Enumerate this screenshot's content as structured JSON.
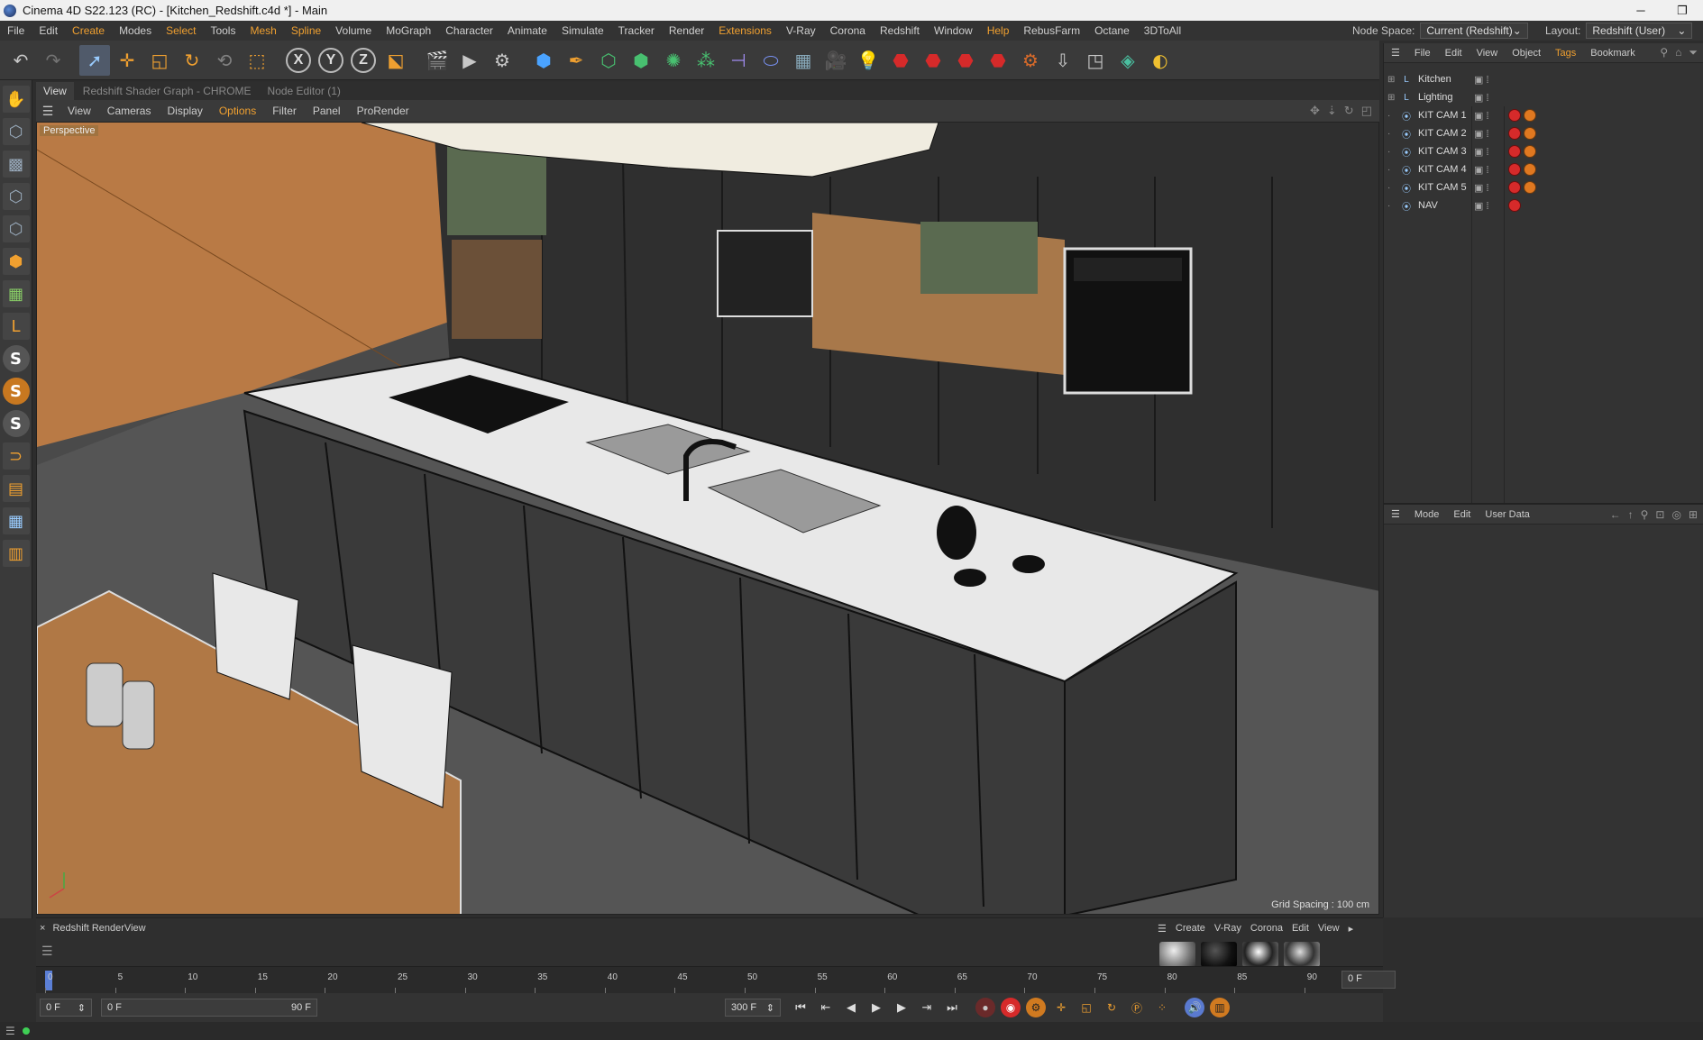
{
  "window": {
    "title": "Cinema 4D S22.123 (RC) - [Kitchen_Redshift.c4d *] - Main",
    "minimize_glyph": "─",
    "restore_glyph": "❐"
  },
  "menubar": {
    "items": [
      "File",
      "Edit",
      "Create",
      "Modes",
      "Select",
      "Tools",
      "Mesh",
      "Spline",
      "Volume",
      "MoGraph",
      "Character",
      "Animate",
      "Simulate",
      "Tracker",
      "Render",
      "Extensions",
      "V-Ray",
      "Corona",
      "Redshift",
      "Window",
      "Help",
      "RebusFarm",
      "Octane",
      "3DToAll"
    ],
    "accent_items": [
      "Create",
      "Select",
      "Mesh",
      "Spline",
      "Extensions",
      "Help"
    ],
    "node_space_label": "Node Space:",
    "node_space_value": "Current (Redshift)",
    "layout_label": "Layout:",
    "layout_value": "Redshift (User)"
  },
  "viewport": {
    "tabs": [
      "View",
      "Redshift Shader Graph - CHROME",
      "Node Editor (1)"
    ],
    "menu": [
      "View",
      "Cameras",
      "Display",
      "Options",
      "Filter",
      "Panel",
      "ProRender"
    ],
    "camera_label": "Perspective",
    "grid_spacing": "Grid Spacing : 100 cm"
  },
  "object_manager": {
    "menu": [
      "File",
      "Edit",
      "View",
      "Object",
      "Tags",
      "Bookmark"
    ],
    "objects": [
      {
        "name": "Kitchen",
        "type": "layer",
        "tags": []
      },
      {
        "name": "Lighting",
        "type": "layer",
        "tags": []
      },
      {
        "name": "KIT CAM 1",
        "type": "camera",
        "tags": [
          "red",
          "orange"
        ]
      },
      {
        "name": "KIT CAM 2",
        "type": "camera",
        "tags": [
          "red",
          "orange"
        ]
      },
      {
        "name": "KIT  CAM 3",
        "type": "camera",
        "tags": [
          "red",
          "orange"
        ]
      },
      {
        "name": "KIT  CAM 4",
        "type": "camera",
        "tags": [
          "red",
          "orange"
        ]
      },
      {
        "name": "KIT  CAM 5",
        "type": "camera",
        "tags": [
          "red",
          "orange"
        ]
      },
      {
        "name": "NAV",
        "type": "camera",
        "tags": [
          "red"
        ]
      }
    ]
  },
  "attribute_manager": {
    "menu": [
      "Mode",
      "Edit",
      "User Data"
    ]
  },
  "render_view": {
    "title": "Redshift RenderView"
  },
  "material_manager": {
    "menu": [
      "Create",
      "V-Ray",
      "Corona",
      "Edit",
      "View"
    ]
  },
  "timeline": {
    "ticks": [
      0,
      5,
      10,
      15,
      20,
      25,
      30,
      35,
      40,
      45,
      50,
      55,
      60,
      65,
      70,
      75,
      80,
      85,
      90
    ],
    "current_frame_display": "0 F"
  },
  "transport": {
    "current_frame": "0 F",
    "range_start": "0 F",
    "range_end": "90 F",
    "max_frame": "300 F"
  },
  "colors": {
    "accent_menu": "#f0a030",
    "tag_red": "#d62a2a",
    "tag_orange": "#e07820",
    "playhead": "#5b7fd6"
  }
}
